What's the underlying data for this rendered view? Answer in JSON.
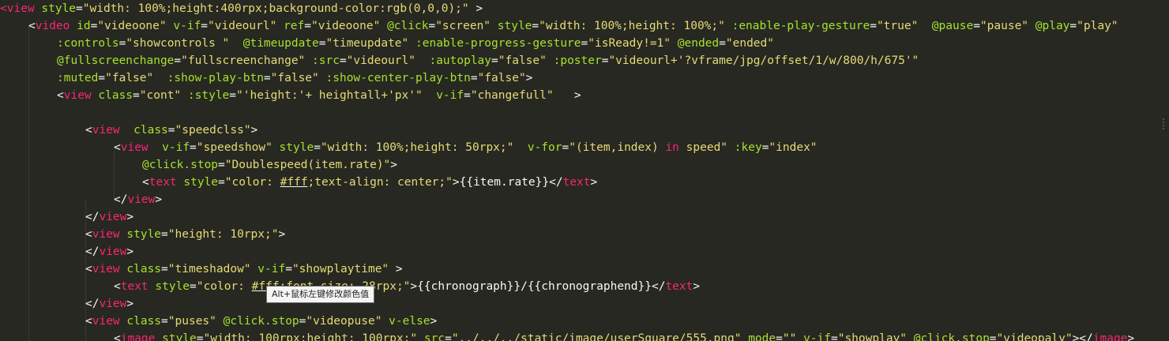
{
  "editor": {
    "lines": [
      [
        [
          "t",
          "<"
        ],
        [
          "g",
          "view"
        ],
        [
          "p",
          " "
        ],
        [
          "a",
          "style"
        ],
        [
          "p",
          "="
        ],
        [
          "s",
          "\"width: 100%;height:400rpx;background-color:rgb(0,0,0);\""
        ],
        [
          "p",
          " >"
        ]
      ],
      [
        [
          "p",
          "<"
        ],
        [
          "g",
          "video"
        ],
        [
          "p",
          " "
        ],
        [
          "a",
          "id"
        ],
        [
          "p",
          "="
        ],
        [
          "s",
          "\"videoone\""
        ],
        [
          "p",
          " "
        ],
        [
          "a",
          "v-if"
        ],
        [
          "p",
          "="
        ],
        [
          "s",
          "\"videourl\""
        ],
        [
          "p",
          " "
        ],
        [
          "a",
          "ref"
        ],
        [
          "p",
          "="
        ],
        [
          "s",
          "\"videoone\""
        ],
        [
          "p",
          " "
        ],
        [
          "a",
          "@click"
        ],
        [
          "p",
          "="
        ],
        [
          "s",
          "\"screen\""
        ],
        [
          "p",
          " "
        ],
        [
          "a",
          "style"
        ],
        [
          "p",
          "="
        ],
        [
          "s",
          "\"width: 100%;height: 100%;\""
        ],
        [
          "p",
          " "
        ],
        [
          "a",
          ":enable-play-gesture"
        ],
        [
          "p",
          "="
        ],
        [
          "s",
          "\"true\""
        ],
        [
          "p",
          "  "
        ],
        [
          "a",
          "@pause"
        ],
        [
          "p",
          "="
        ],
        [
          "s",
          "\"pause\""
        ],
        [
          "p",
          " "
        ],
        [
          "a",
          "@play"
        ],
        [
          "p",
          "="
        ],
        [
          "s",
          "\"play\""
        ]
      ],
      [
        [
          "a",
          ":controls"
        ],
        [
          "p",
          "="
        ],
        [
          "s",
          "\"showcontrols \""
        ],
        [
          "p",
          "  "
        ],
        [
          "a",
          "@timeupdate"
        ],
        [
          "p",
          "="
        ],
        [
          "s",
          "\"timeupdate\""
        ],
        [
          "p",
          " "
        ],
        [
          "a",
          ":enable-progress-gesture"
        ],
        [
          "p",
          "="
        ],
        [
          "s",
          "\"isReady!=1\""
        ],
        [
          "p",
          " "
        ],
        [
          "a",
          "@ended"
        ],
        [
          "p",
          "="
        ],
        [
          "s",
          "\"ended\""
        ]
      ],
      [
        [
          "a",
          "@fullscreenchange"
        ],
        [
          "p",
          "="
        ],
        [
          "s",
          "\"fullscreenchange\""
        ],
        [
          "p",
          " "
        ],
        [
          "a",
          ":src"
        ],
        [
          "p",
          "="
        ],
        [
          "s",
          "\"videourl\""
        ],
        [
          "p",
          "  "
        ],
        [
          "a",
          ":autoplay"
        ],
        [
          "p",
          "="
        ],
        [
          "s",
          "\"false\""
        ],
        [
          "p",
          " "
        ],
        [
          "a",
          ":poster"
        ],
        [
          "p",
          "="
        ],
        [
          "s",
          "\"videourl+'?vframe/jpg/offset/1/w/800/h/675'\""
        ]
      ],
      [
        [
          "a",
          ":muted"
        ],
        [
          "p",
          "="
        ],
        [
          "s",
          "\"false\""
        ],
        [
          "p",
          "  "
        ],
        [
          "a",
          ":show-play-btn"
        ],
        [
          "p",
          "="
        ],
        [
          "s",
          "\"false\""
        ],
        [
          "p",
          " "
        ],
        [
          "a",
          ":show-center-play-btn"
        ],
        [
          "p",
          "="
        ],
        [
          "s",
          "\"false\""
        ],
        [
          "p",
          ">"
        ]
      ],
      [
        [
          "p",
          "<"
        ],
        [
          "g",
          "view"
        ],
        [
          "p",
          " "
        ],
        [
          "a",
          "class"
        ],
        [
          "p",
          "="
        ],
        [
          "s",
          "\"cont\""
        ],
        [
          "p",
          " "
        ],
        [
          "a",
          ":style"
        ],
        [
          "p",
          "="
        ],
        [
          "s",
          "\"'height:'+ heightall+'px'\""
        ],
        [
          "p",
          "  "
        ],
        [
          "a",
          "v-if"
        ],
        [
          "p",
          "="
        ],
        [
          "s",
          "\"changefull\""
        ],
        [
          "p",
          "   >"
        ]
      ],
      [],
      [
        [
          "p",
          "<"
        ],
        [
          "g",
          "view"
        ],
        [
          "p",
          "  "
        ],
        [
          "a",
          "class"
        ],
        [
          "p",
          "="
        ],
        [
          "s",
          "\"speedclss\""
        ],
        [
          "p",
          ">"
        ]
      ],
      [
        [
          "p",
          "<"
        ],
        [
          "g",
          "view"
        ],
        [
          "p",
          "  "
        ],
        [
          "a",
          "v-if"
        ],
        [
          "p",
          "="
        ],
        [
          "s",
          "\"speedshow\""
        ],
        [
          "p",
          " "
        ],
        [
          "a",
          "style"
        ],
        [
          "p",
          "="
        ],
        [
          "s",
          "\"width: 100%;height: 50rpx;\""
        ],
        [
          "p",
          "  "
        ],
        [
          "a",
          "v-for"
        ],
        [
          "p",
          "="
        ],
        [
          "s",
          "\"(item,index) "
        ],
        [
          "k",
          "in"
        ],
        [
          "s",
          " speed\""
        ],
        [
          "p",
          " "
        ],
        [
          "a",
          ":key"
        ],
        [
          "p",
          "="
        ],
        [
          "s",
          "\"index\""
        ]
      ],
      [
        [
          "a",
          "@click.stop"
        ],
        [
          "p",
          "="
        ],
        [
          "s",
          "\"Doublespeed(item.rate)\""
        ],
        [
          "p",
          ">"
        ]
      ],
      [
        [
          "p",
          "<"
        ],
        [
          "g",
          "text"
        ],
        [
          "p",
          " "
        ],
        [
          "a",
          "style"
        ],
        [
          "p",
          "="
        ],
        [
          "s",
          "\"color: "
        ],
        [
          "c",
          "#fff"
        ],
        [
          "s",
          ";text-align: center;\""
        ],
        [
          "p",
          ">{{item.rate}}</"
        ],
        [
          "g",
          "text"
        ],
        [
          "p",
          ">"
        ]
      ],
      [
        [
          "p",
          "</"
        ],
        [
          "g",
          "view"
        ],
        [
          "p",
          ">"
        ]
      ],
      [
        [
          "p",
          "</"
        ],
        [
          "g",
          "view"
        ],
        [
          "p",
          ">"
        ]
      ],
      [
        [
          "p",
          "<"
        ],
        [
          "g",
          "view"
        ],
        [
          "p",
          " "
        ],
        [
          "a",
          "style"
        ],
        [
          "p",
          "="
        ],
        [
          "s",
          "\"height: 10rpx;\""
        ],
        [
          "p",
          ">"
        ]
      ],
      [
        [
          "p",
          "</"
        ],
        [
          "g",
          "view"
        ],
        [
          "p",
          ">"
        ]
      ],
      [
        [
          "p",
          "<"
        ],
        [
          "g",
          "view"
        ],
        [
          "p",
          " "
        ],
        [
          "a",
          "class"
        ],
        [
          "p",
          "="
        ],
        [
          "s",
          "\"timeshadow\""
        ],
        [
          "p",
          " "
        ],
        [
          "a",
          "v-if"
        ],
        [
          "p",
          "="
        ],
        [
          "s",
          "\"showplaytime\""
        ],
        [
          "p",
          " >"
        ]
      ],
      [
        [
          "p",
          "<"
        ],
        [
          "g",
          "text"
        ],
        [
          "p",
          " "
        ],
        [
          "a",
          "style"
        ],
        [
          "p",
          "="
        ],
        [
          "s",
          "\"color: "
        ],
        [
          "c",
          "#fff"
        ],
        [
          "s",
          ";font-size: 28rpx;\""
        ],
        [
          "p",
          ">{{chronograph}}/{{chronographend}}</"
        ],
        [
          "g",
          "text"
        ],
        [
          "p",
          ">"
        ]
      ],
      [
        [
          "p",
          "</"
        ],
        [
          "g",
          "view"
        ],
        [
          "p",
          ">"
        ]
      ],
      [
        [
          "p",
          "<"
        ],
        [
          "g",
          "view"
        ],
        [
          "p",
          " "
        ],
        [
          "a",
          "class"
        ],
        [
          "p",
          "="
        ],
        [
          "s",
          "\"puses\""
        ],
        [
          "p",
          " "
        ],
        [
          "a",
          "@click.stop"
        ],
        [
          "p",
          "="
        ],
        [
          "s",
          "\"videopuse\""
        ],
        [
          "p",
          " "
        ],
        [
          "a",
          "v-else"
        ],
        [
          "p",
          ">"
        ]
      ],
      [
        [
          "p",
          "<"
        ],
        [
          "g",
          "image"
        ],
        [
          "p",
          " "
        ],
        [
          "a",
          "style"
        ],
        [
          "p",
          "="
        ],
        [
          "s",
          "\"width: 100rpx;height: 100rpx;\""
        ],
        [
          "p",
          " "
        ],
        [
          "a",
          "src"
        ],
        [
          "p",
          "="
        ],
        [
          "s",
          "\"../../../static/image/userSquare/555.png\""
        ],
        [
          "p",
          " "
        ],
        [
          "a",
          "mode"
        ],
        [
          "p",
          "="
        ],
        [
          "s",
          "\"\""
        ],
        [
          "p",
          " "
        ],
        [
          "a",
          "v-if"
        ],
        [
          "p",
          "="
        ],
        [
          "s",
          "\"showplay\""
        ],
        [
          "p",
          " "
        ],
        [
          "a",
          "@click.stop"
        ],
        [
          "p",
          "="
        ],
        [
          "s",
          "\"videopaly\""
        ],
        [
          "p",
          "></"
        ],
        [
          "g",
          "image"
        ],
        [
          "p",
          ">"
        ]
      ]
    ]
  },
  "tooltip": {
    "text": "Alt+鼠标左键修改颜色值"
  },
  "colors": {
    "background": "#272822",
    "tag": "#f92672",
    "attribute": "#a6e22e",
    "string": "#e6db74",
    "text": "#f8f8f2"
  }
}
